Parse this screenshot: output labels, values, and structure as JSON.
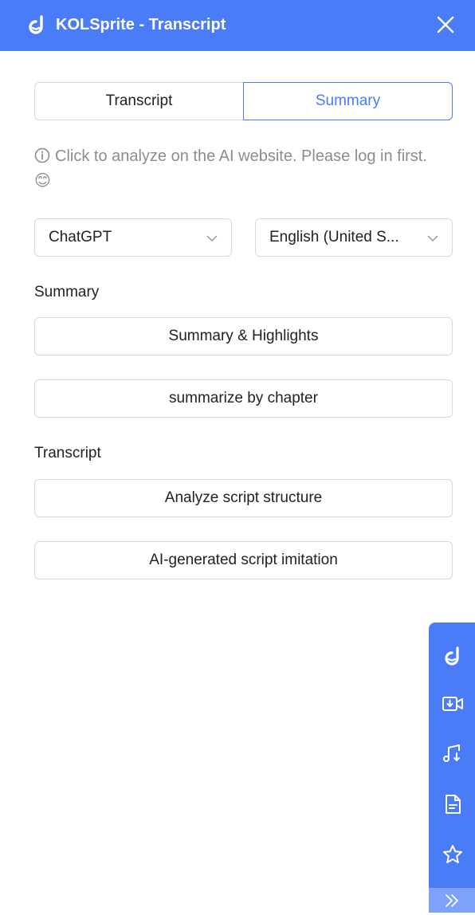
{
  "header": {
    "title": "KOLSprite - Transcript",
    "logo_icon": "kolsprite-logo-icon",
    "close_icon": "close-icon"
  },
  "tabs": [
    {
      "label": "Transcript",
      "active": false
    },
    {
      "label": "Summary",
      "active": true
    }
  ],
  "hint": {
    "icon": "info-icon",
    "text": "Click to analyze on the AI website. Please log in first. 😊"
  },
  "selects": {
    "model": {
      "value": "ChatGPT"
    },
    "language": {
      "value": "English (United S..."
    }
  },
  "sections": {
    "summary": {
      "label": "Summary",
      "buttons": [
        "Summary & Highlights",
        "summarize by chapter"
      ]
    },
    "transcript": {
      "label": "Transcript",
      "buttons": [
        "Analyze script structure",
        "AI-generated script imitation"
      ]
    }
  },
  "sidebar": {
    "icons": [
      "kolsprite-logo-icon",
      "video-download-icon",
      "music-download-icon",
      "document-icon",
      "star-icon"
    ],
    "expand_icon": "double-chevron-right-icon"
  },
  "colors": {
    "accent": "#4a7cf7",
    "hint_text": "#8c8c8c",
    "border": "#d9d9d9"
  }
}
